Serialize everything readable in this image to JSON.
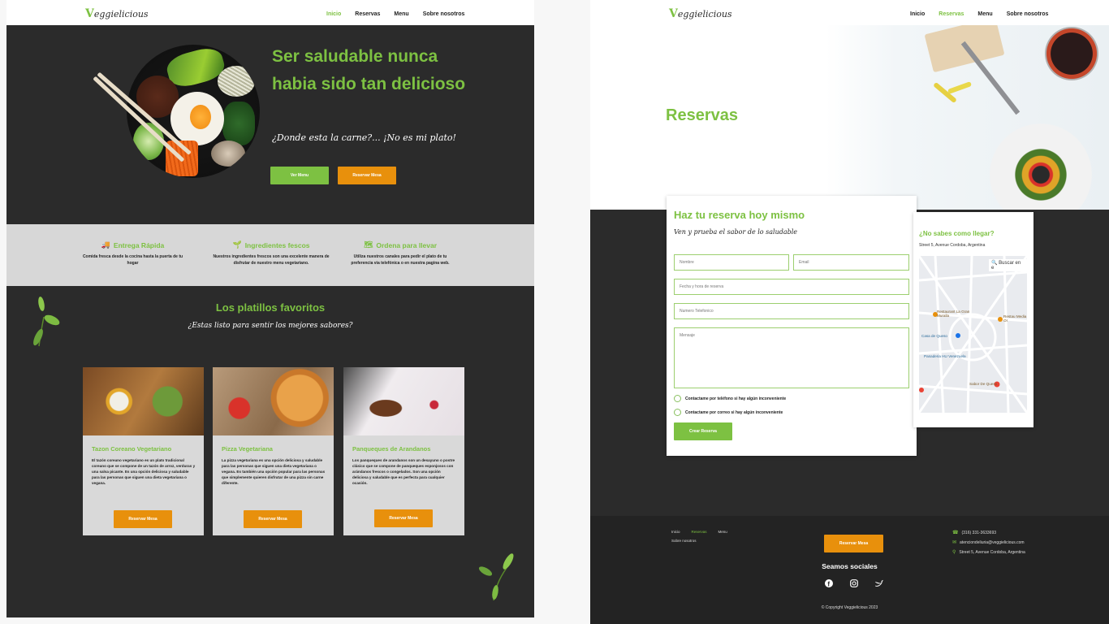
{
  "brand": {
    "logo_v": "V",
    "logo_rest": "eggielicious"
  },
  "left": {
    "nav": {
      "items": [
        "Inicio",
        "Reservas",
        "Menu",
        "Sobre nosotros"
      ]
    },
    "hero": {
      "title": "Ser saludable nunca habia sido tan delicioso",
      "subtitle": "¿Donde esta la carne?... ¡No es mi plato!",
      "btn_menu": "Ver Menu",
      "btn_reserve": "Reservar Mesa"
    },
    "features": [
      {
        "icon": "truck-icon",
        "glyph": "🚚",
        "title": "Entrega Rápida",
        "text": "Comida fresca desde la cocina hasta la puerta de tu hogar"
      },
      {
        "icon": "sprout-icon",
        "glyph": "🌱",
        "title": "Ingredientes fescos",
        "text": "Nuestros ingredientes frescos son una excelente manera de disfrutar de nuestro menu vegetariano."
      },
      {
        "icon": "map-icon",
        "glyph": "🗺",
        "title": "Ordena para llevar",
        "text": "Utiliza nuestros canales para pedir el plato de tu preferencia via telefónica o en nuestra pagina web."
      }
    ],
    "favorites": {
      "title": "Los platillos favoritos",
      "subtitle": "¿Estas listo para sentir los mejores sabores?",
      "cards": [
        {
          "title": "Tazon Coreano Vegetariano",
          "text": "El tazón coreano vegetariano es un plato tradicional coreano que se compone de un tazón de arroz, verduras y una salsa picante. Es una opción deliciosa y saludable para las personas que siguen una dieta vegetariana o vegana.",
          "button": "Reservar Mesa"
        },
        {
          "title": "Pizza Vegetariana",
          "text": "La pizza vegetariana es una opción deliciosa y saludable para las personas que siguen una dieta vegetariana o vegana. Es también una opción popular para las personas que simplemente quieren disfrutar de una pizza sin carne diferente.",
          "button": "Reservar Mesa"
        },
        {
          "title": "Panqueques de Arandanos",
          "text": "Los panqueques de arandanos son un desayuno o postre clásico que se compone de panqueques esponjosos con arándanos frescos o congelados. Son una opción deliciosa y saludable que es perfecta para cualquier ocasión.",
          "button": "Reservar Mesa"
        }
      ]
    }
  },
  "right": {
    "nav": {
      "items": [
        "Inicio",
        "Reservas",
        "Menu",
        "Sobre nosotros"
      ]
    },
    "hero_title": "Reservas",
    "form": {
      "title": "Haz tu reserva hoy mismo",
      "subtitle": "Ven y prueba el sabor de lo saludable",
      "name_placeholder": "Nombre",
      "email_placeholder": "Email",
      "date_placeholder": "Fecha y hora de reserva",
      "phone_placeholder": "Numero Telefonico",
      "message_placeholder": "Mensaje",
      "check_phone": "Contactame por teléfono si hay algún inconveniente",
      "check_email": "Contactame por correo si hay algún inconveniente",
      "submit": "Crear Reserva"
    },
    "map": {
      "title": "¿No sabes como llegar?",
      "address": "Street 5, Avenue Cordoba, Argentina",
      "search": "Buscar en e",
      "labels": [
        "Restaurant La Gran Muralla",
        "Restau Media Or",
        "Casa de Queso",
        "Panaderia HU Venezuela",
        "Sabor De Queso"
      ]
    },
    "footer": {
      "links": [
        "Inicio",
        "Reservas",
        "Menu"
      ],
      "link_about": "Sobre nosotros",
      "button": "Reservar Mesa",
      "social_title": "Seamos sociales",
      "phone": "(316) 331-3633693",
      "email": "atenciondeliuria@veggielicious.com",
      "address": "Street 5, Avenue Cordoba, Argentina",
      "copyright": "© Copyright Veggielicious 2023"
    }
  },
  "colors": {
    "green": "#7dc142",
    "orange": "#e8900c",
    "dark": "#2b2b2b",
    "gray": "#d7d7d7"
  }
}
